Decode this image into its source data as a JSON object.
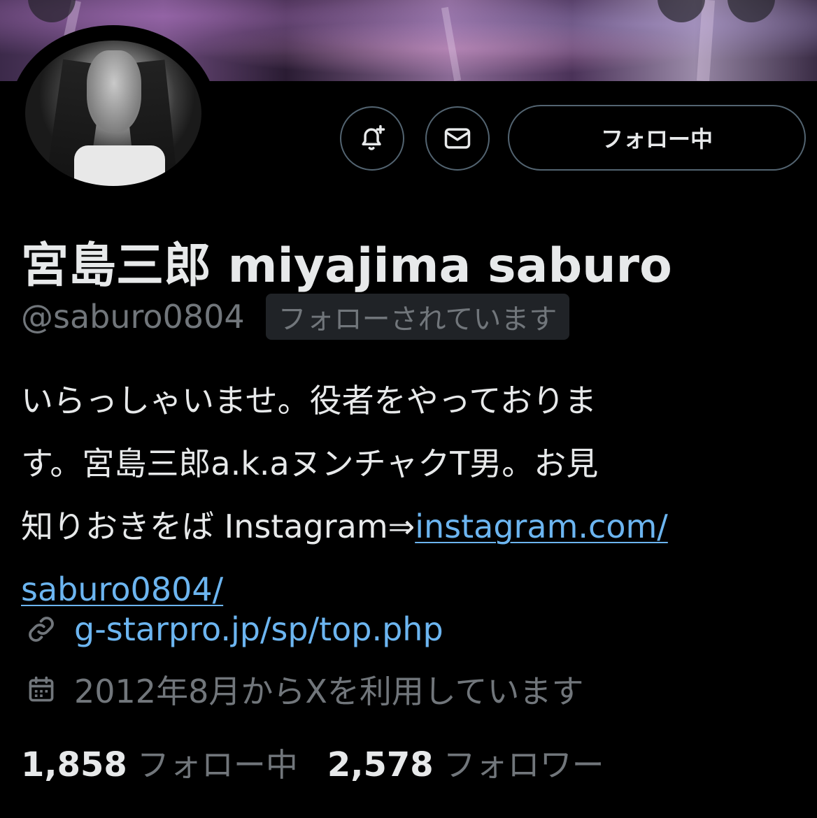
{
  "profile": {
    "display_name": "宮島三郎 miyajima saburo",
    "handle": "@saburo0804",
    "follows_you_badge": "フォローされています",
    "bio_lines": [
      "いらっしゃいませ。役者をやっておりま",
      "す。宮島三郎a.k.aヌンチャクT男。お見"
    ],
    "bio_line3_text": "知りおきをば Instagram⇒",
    "bio_link_part1": "instagram.com/",
    "bio_link_part2": "saburo0804/",
    "website": "g-starpro.jp/sp/top.php",
    "joined": "2012年8月からXを利用しています"
  },
  "actions": {
    "notify_icon": "bell-plus-icon",
    "message_icon": "envelope-icon",
    "follow_button_label": "フォロー中"
  },
  "stats": {
    "following_count": "1,858",
    "following_label": "フォロー中",
    "followers_count": "2,578",
    "followers_label": "フォロワー"
  },
  "icons": {
    "website_icon": "link-icon",
    "joined_icon": "calendar-icon"
  },
  "colors": {
    "background": "#000000",
    "primary_text": "#e7e9ea",
    "secondary_text": "#71767b",
    "link": "#6cb5f0",
    "border": "#536471",
    "badge_bg": "#202327"
  }
}
